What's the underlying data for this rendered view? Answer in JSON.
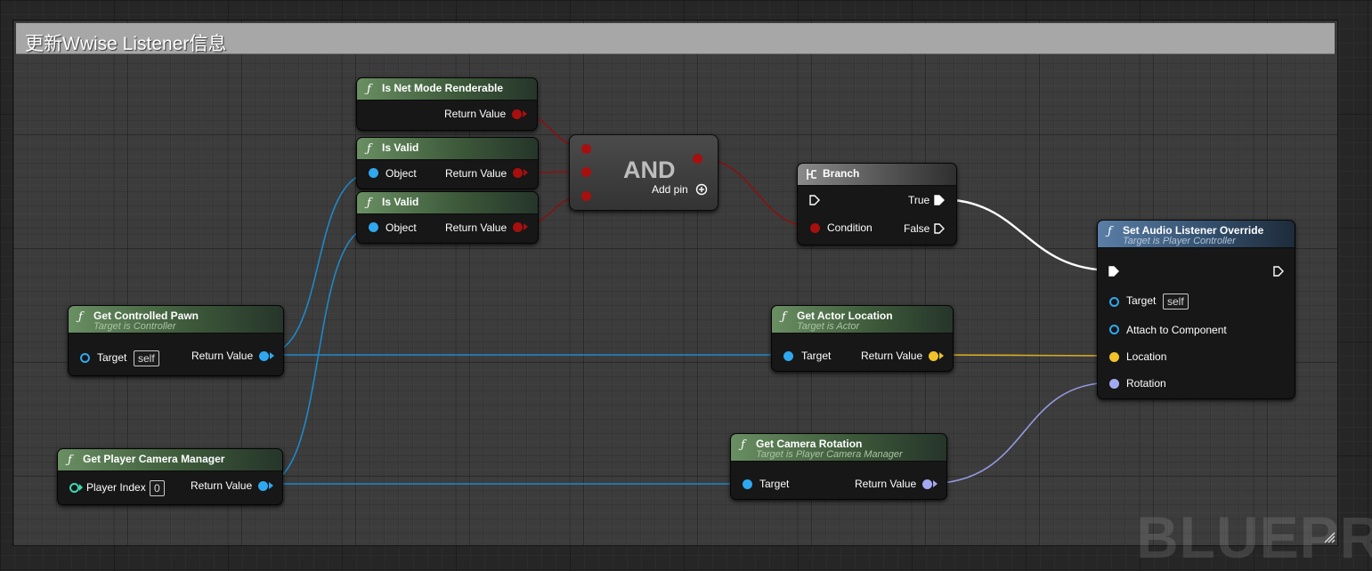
{
  "comment": {
    "title": "更新Wwise Listener信息",
    "color": "#a7a7a7"
  },
  "watermark": "BLUEPRINT",
  "colors": {
    "object_pin": "#2fa8f0",
    "bool_pin": "#a80f0f",
    "vector_pin": "#f0c22c",
    "rotator_pin": "#a3a9f0",
    "int_pin": "#3fd7b2",
    "exec_pin": "#ffffff"
  },
  "nodes": {
    "net_mode": {
      "title": "Is Net Mode Renderable",
      "icon": "function-icon",
      "return_label": "Return Value"
    },
    "is_valid_1": {
      "title": "Is Valid",
      "icon": "function-icon",
      "input_label": "Object",
      "return_label": "Return Value"
    },
    "is_valid_2": {
      "title": "Is Valid",
      "icon": "function-icon",
      "input_label": "Object",
      "return_label": "Return Value"
    },
    "and_node": {
      "title": "AND",
      "add_pin_label": "Add pin"
    },
    "branch": {
      "title": "Branch",
      "icon": "branch-icon",
      "condition_label": "Condition",
      "true_label": "True",
      "false_label": "False"
    },
    "set_listener": {
      "title": "Set Audio Listener Override",
      "subtitle": "Target is Player Controller",
      "target_label": "Target",
      "target_value": "self",
      "attach_label": "Attach to Component",
      "location_label": "Location",
      "rotation_label": "Rotation"
    },
    "get_pawn": {
      "title": "Get Controlled Pawn",
      "subtitle": "Target is Controller",
      "target_label": "Target",
      "target_value": "self",
      "return_label": "Return Value"
    },
    "actor_location": {
      "title": "Get Actor Location",
      "subtitle": "Target is Actor",
      "target_label": "Target",
      "return_label": "Return Value"
    },
    "camera_manager": {
      "title": "Get Player Camera Manager",
      "index_label": "Player Index",
      "index_value": "0",
      "return_label": "Return Value"
    },
    "camera_rotation": {
      "title": "Get Camera Rotation",
      "subtitle": "Target is Player Camera Manager",
      "target_label": "Target",
      "return_label": "Return Value"
    }
  }
}
